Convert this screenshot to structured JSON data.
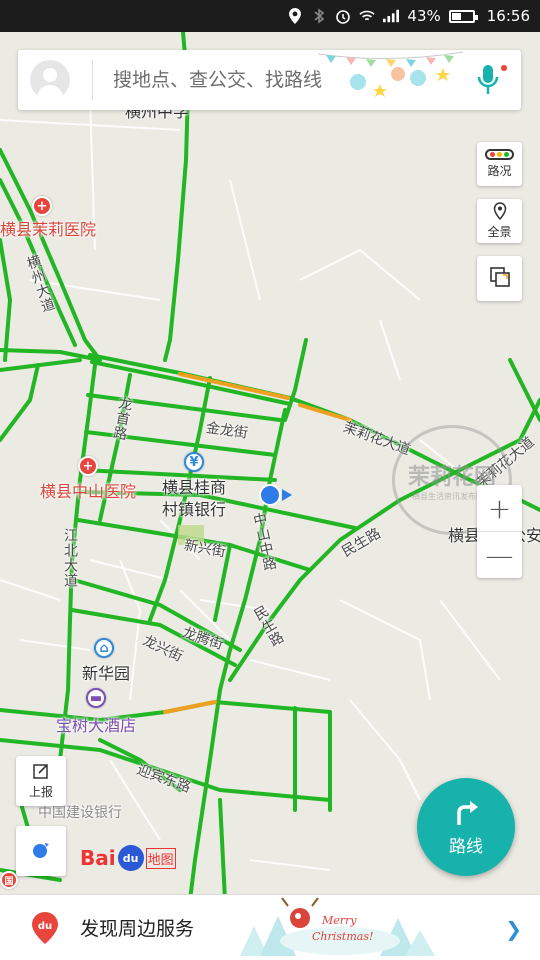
{
  "status_bar": {
    "battery": "43%",
    "time": "16:56",
    "icons": [
      "location-icon",
      "bluetooth-icon",
      "alarm-icon",
      "wifi-icon",
      "signal-icon",
      "battery-icon"
    ]
  },
  "search": {
    "placeholder": "搜地点、查公交、找路线"
  },
  "tools": {
    "traffic": "路况",
    "panorama": "全景",
    "layers": ""
  },
  "zoom": {
    "in": "+",
    "out": "—"
  },
  "report": "上报",
  "route_button": "路线",
  "logo": {
    "brand_left": "Bai",
    "brand_paw": "du",
    "brand_right": "地图"
  },
  "bottom": {
    "title": "发现周边服务"
  },
  "xmas_text": "Merry Christmas!",
  "watermark": {
    "text": "茉莉花网",
    "sub": "横县生活资讯发布网站"
  },
  "map": {
    "pois": {
      "hospital1": "横县茉莉医院",
      "hospital2": "横县中山医院",
      "bank": "横县桂商村镇银行",
      "bank_line1": "横县桂商",
      "bank_line2": "村镇银行",
      "community": "新华园",
      "hotel": "宝树大酒店",
      "ccb": "中国建设银行",
      "school_top": "横州中学",
      "right_clip": "横县",
      "right_clip2": "公安"
    },
    "roads": {
      "hengzhou": "横州大道",
      "longshou": "龙首路",
      "jinlong": "金龙街",
      "xinxing": "新兴街",
      "zhongshan": "中山中路",
      "jiangbei": "江北大道",
      "longteng": "龙腾街",
      "longxing": "龙兴街",
      "minsheng": "民生路",
      "minsheng2": "民生路",
      "molihua": "茉莉花大道",
      "molihua2": "茉莉花大道",
      "yingbin": "迎宾东路"
    }
  },
  "colors": {
    "road_green": "#22b524",
    "road_orange": "#f0a020",
    "map_bg": "#ebeae3",
    "teal": "#17b2ab",
    "location_blue": "#2f7be8"
  }
}
